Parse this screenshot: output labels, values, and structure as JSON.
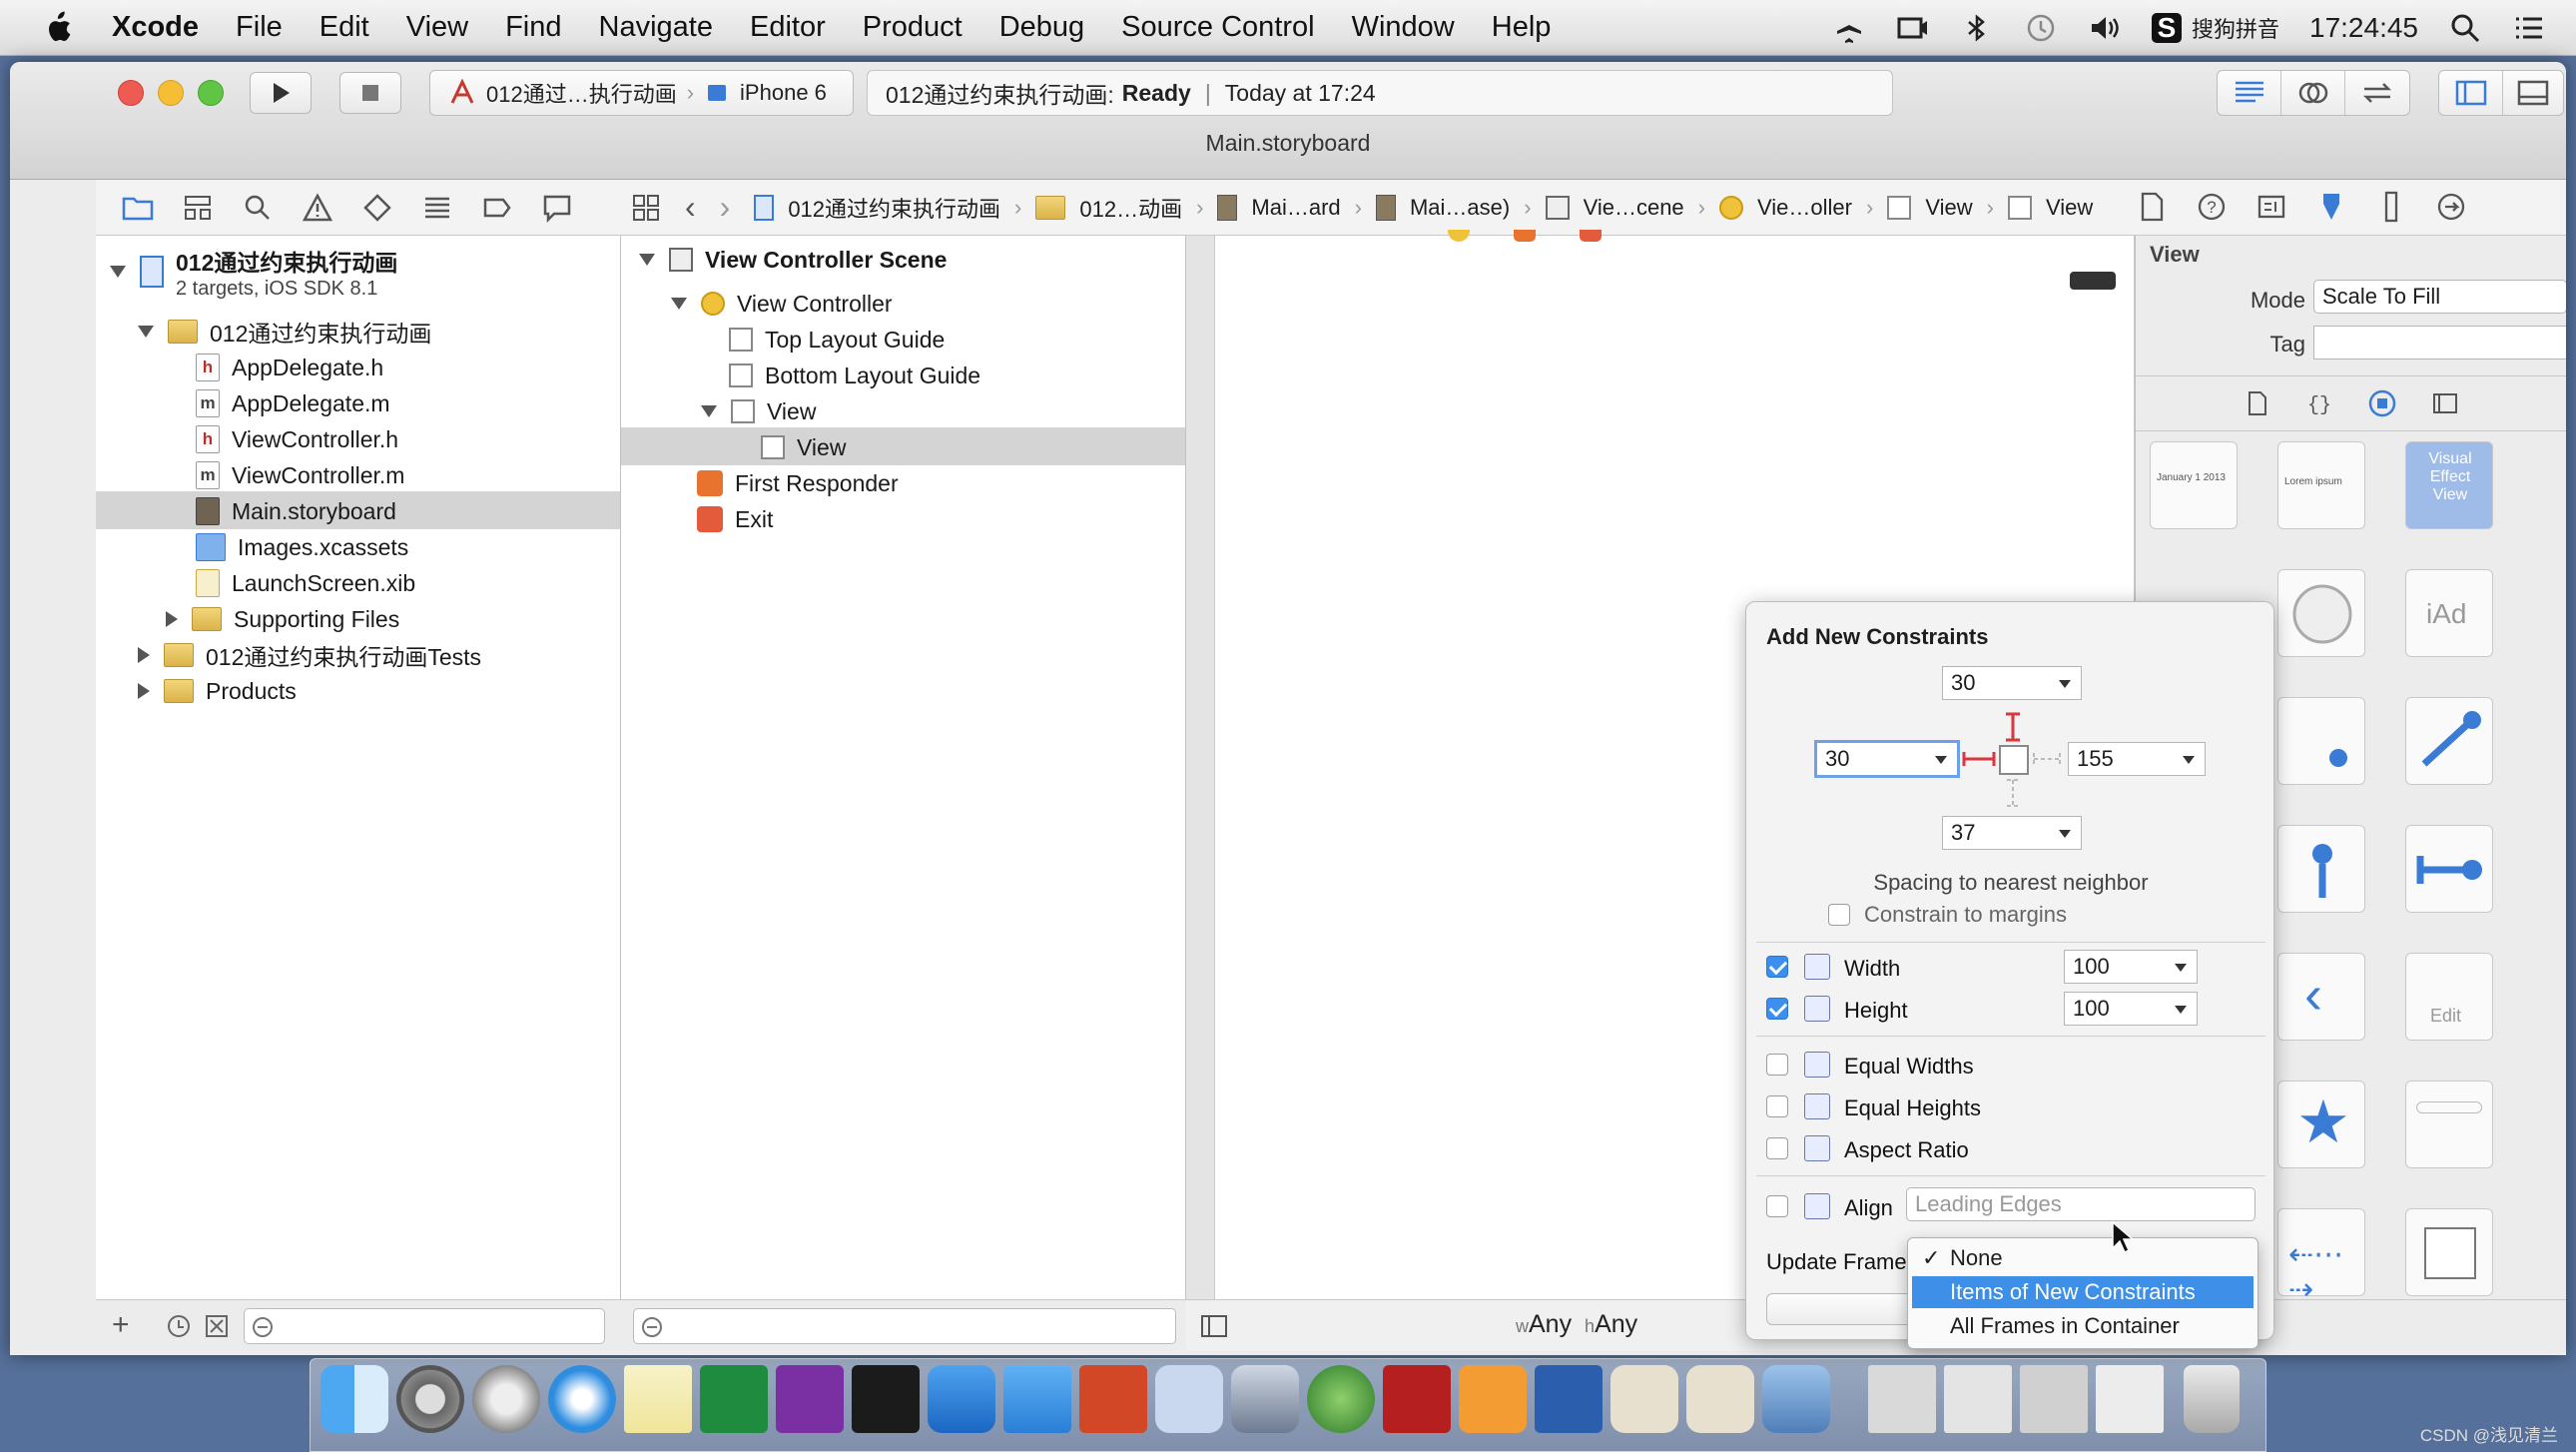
{
  "menubar": {
    "app": "Xcode",
    "items": [
      "File",
      "Edit",
      "View",
      "Find",
      "Navigate",
      "Editor",
      "Product",
      "Debug",
      "Source Control",
      "Window",
      "Help"
    ],
    "input_method": "搜狗拼音",
    "clock": "17:24:45"
  },
  "toolbar": {
    "scheme_name": "012通过…执行动画",
    "device": "iPhone 6",
    "activity_project": "012通过约束执行动画:",
    "activity_status": "Ready",
    "activity_separator": "|",
    "activity_time": "Today at 17:24",
    "window_title": "Main.storyboard"
  },
  "jumpbar": {
    "crumbs": [
      "012通过约束执行动画",
      "012…动画",
      "Mai…ard",
      "Mai…ase)",
      "Vie…cene",
      "Vie…oller",
      "View",
      "View"
    ]
  },
  "navigator": {
    "project_name": "012通过约束执行动画",
    "project_sub": "2 targets, iOS SDK 8.1",
    "group_name": "012通过约束执行动画",
    "files": [
      {
        "badge": "h",
        "name": "AppDelegate.h"
      },
      {
        "badge": "m",
        "name": "AppDelegate.m"
      },
      {
        "badge": "h",
        "name": "ViewController.h"
      },
      {
        "badge": "m",
        "name": "ViewController.m"
      },
      {
        "badge": "",
        "name": "Main.storyboard"
      },
      {
        "badge": "",
        "name": "Images.xcassets"
      },
      {
        "badge": "",
        "name": "LaunchScreen.xib"
      }
    ],
    "supporting": "Supporting Files",
    "tests": "012通过约束执行动画Tests",
    "products": "Products"
  },
  "outline": {
    "scene": "View Controller Scene",
    "controller": "View Controller",
    "top_guide": "Top Layout Guide",
    "bottom_guide": "Bottom Layout Guide",
    "view": "View",
    "subview": "View",
    "first_responder": "First Responder",
    "exit": "Exit"
  },
  "constraints": {
    "title": "Add New Constraints",
    "top": "30",
    "left": "30",
    "right": "155",
    "bottom": "37",
    "spacing_label": "Spacing to nearest neighbor",
    "margins_label": "Constrain to margins",
    "width_label": "Width",
    "width_value": "100",
    "height_label": "Height",
    "height_value": "100",
    "equal_widths": "Equal Widths",
    "equal_heights": "Equal Heights",
    "aspect_ratio": "Aspect Ratio",
    "align_label": "Align",
    "align_value": "Leading Edges",
    "update_frames": "Update Frame"
  },
  "update_menu": {
    "check": "✓",
    "items": [
      "None",
      "Items of New Constraints",
      "All Frames in Container"
    ]
  },
  "canvas": {
    "size_w_prefix": "w",
    "size_w": "Any",
    "size_h_prefix": "h",
    "size_h": "Any"
  },
  "inspector": {
    "section": "View",
    "mode_label": "Mode",
    "mode_value": "Scale To Fill",
    "tag_label": "Tag",
    "lib_date": "January 1 2013",
    "lib_lorem": "Lorem ipsum",
    "lib_visual": "Visual Effect View",
    "lib_iad": "iAd",
    "lib_edit": "Edit"
  },
  "watermark": "CSDN @浅见清兰",
  "colors": {
    "accent": "#3d8fe8",
    "constraint": "#d9363e",
    "selection": "#d4d4d4"
  }
}
